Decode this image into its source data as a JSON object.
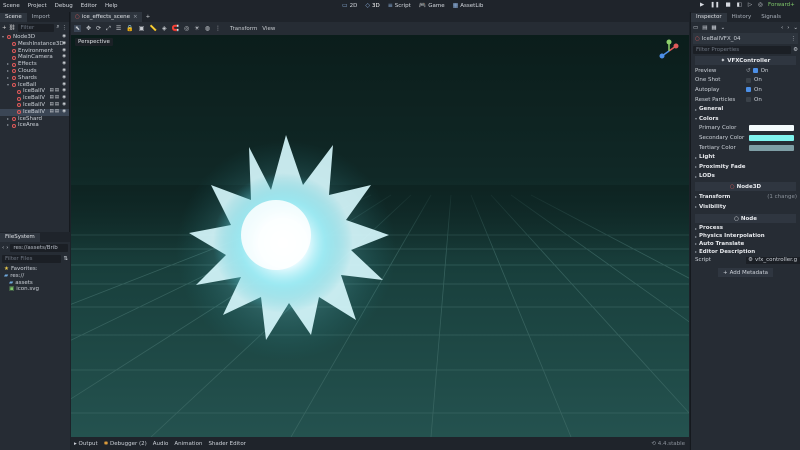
{
  "menu": [
    "Scene",
    "Project",
    "Debug",
    "Editor",
    "Help"
  ],
  "workspaces": [
    {
      "label": "2D",
      "icon": "2d-icon",
      "active": false
    },
    {
      "label": "3D",
      "icon": "3d-icon",
      "active": true
    },
    {
      "label": "Script",
      "icon": "script-icon",
      "active": false
    },
    {
      "label": "Game",
      "icon": "game-icon",
      "active": false
    },
    {
      "label": "AssetLib",
      "icon": "assetlib-icon",
      "active": false
    }
  ],
  "renderer": "Forward+",
  "scene_dock": {
    "tabs": [
      "Scene",
      "Import"
    ],
    "filter_placeholder": "Filter",
    "tree": [
      {
        "label": "Node3D",
        "depth": 0,
        "arrow": "▾",
        "eye": true
      },
      {
        "label": "MeshInstance3D",
        "depth": 1,
        "arrow": "",
        "eye": true
      },
      {
        "label": "Environment",
        "depth": 1,
        "arrow": "",
        "eye": true
      },
      {
        "label": "MainCamera",
        "depth": 1,
        "arrow": "",
        "eye": true
      },
      {
        "label": "Effects",
        "depth": 1,
        "arrow": "▸",
        "eye": true
      },
      {
        "label": "Clouds",
        "depth": 1,
        "arrow": "▸",
        "eye": true
      },
      {
        "label": "Shards",
        "depth": 1,
        "arrow": "▸",
        "eye": true
      },
      {
        "label": "IceBall",
        "depth": 1,
        "arrow": "▾",
        "eye": true
      },
      {
        "label": "IceBallV",
        "depth": 2,
        "arrow": "",
        "eye": true
      },
      {
        "label": "IceBallV",
        "depth": 2,
        "arrow": "",
        "eye": true
      },
      {
        "label": "IceBallV",
        "depth": 2,
        "arrow": "",
        "eye": true
      },
      {
        "label": "IceBallV",
        "depth": 2,
        "arrow": "",
        "eye": true,
        "selected": true
      },
      {
        "label": "IceShard",
        "depth": 1,
        "arrow": "▸",
        "eye": false
      },
      {
        "label": "IceArea",
        "depth": 1,
        "arrow": "▸",
        "eye": false
      }
    ]
  },
  "filesystem": {
    "tab": "FileSystem",
    "path": "res://assets/Brib",
    "filter_placeholder": "Filter Files",
    "items": [
      {
        "label": "Favorites:",
        "icon": "star-icon",
        "depth": 0
      },
      {
        "label": "res://",
        "icon": "folder-icon",
        "depth": 0
      },
      {
        "label": "assets",
        "icon": "folder-icon",
        "depth": 1
      },
      {
        "label": "icon.svg",
        "icon": "image-icon",
        "depth": 1
      }
    ]
  },
  "viewport": {
    "scene_tab": "ice_effects_scene",
    "menus": [
      "Transform",
      "View"
    ],
    "perspective": "Perspective"
  },
  "bottom_panel": {
    "tabs": [
      "Output",
      "Debugger (2)",
      "Audio",
      "Animation",
      "Shader Editor"
    ],
    "version": "4.4.stable"
  },
  "inspector": {
    "tabs": [
      "Inspector",
      "History",
      "Signals"
    ],
    "node_name": "IceBallVFX_04",
    "filter_placeholder": "Filter Properties",
    "class_header": "VFXController",
    "props": [
      {
        "label": "Preview",
        "value": "On",
        "checked": true
      },
      {
        "label": "One Shot",
        "value": "On",
        "checked": false
      },
      {
        "label": "Autoplay",
        "value": "On",
        "checked": true
      },
      {
        "label": "Reset Particles",
        "value": "On",
        "checked": false
      }
    ],
    "groups": {
      "general": "General",
      "colors": "Colors",
      "light": "Light",
      "proximity": "Proximity Fade",
      "lods": "LODs"
    },
    "colors": [
      {
        "label": "Primary Color",
        "color": "#f4fbfd"
      },
      {
        "label": "Secondary Color",
        "color": "#7ff3ee"
      },
      {
        "label": "Tertiary Color",
        "color": "#7e9ea5"
      }
    ],
    "node3d_header": "Node3D",
    "transform": "Transform",
    "transform_changes": "(1 change)",
    "visibility": "Visibility",
    "node_header": "Node",
    "node_sections": [
      "Process",
      "Physics Interpolation",
      "Auto Translate",
      "Editor Description"
    ],
    "script_label": "Script",
    "script_value": "vfx_controller.g",
    "add_metadata": "Add Metadata"
  }
}
